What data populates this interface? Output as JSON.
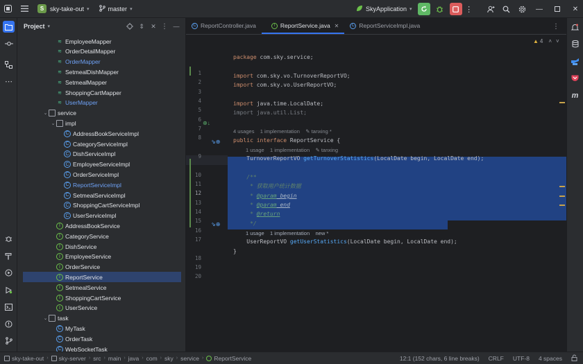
{
  "titlebar": {
    "project_badge": "S",
    "project_name": "sky-take-out",
    "branch": "master",
    "run_config": "SkyApplication"
  },
  "project_panel": {
    "title": "Project",
    "items": [
      {
        "label": "EmployeeMapper",
        "indent": 2,
        "icon": "mapper-icon",
        "color": "normal"
      },
      {
        "label": "OrderDetailMapper",
        "indent": 2,
        "icon": "mapper-icon",
        "color": "normal"
      },
      {
        "label": "OrderMapper",
        "indent": 2,
        "icon": "mapper-icon",
        "color": "blue"
      },
      {
        "label": "SetmealDishMapper",
        "indent": 2,
        "icon": "mapper-icon",
        "color": "normal"
      },
      {
        "label": "SetmealMapper",
        "indent": 2,
        "icon": "mapper-icon",
        "color": "normal"
      },
      {
        "label": "ShoppingCartMapper",
        "indent": 2,
        "icon": "mapper-icon",
        "color": "normal"
      },
      {
        "label": "UserMapper",
        "indent": 2,
        "icon": "mapper-icon",
        "color": "blue"
      },
      {
        "label": "service",
        "indent": 1,
        "icon": "folder-icon",
        "color": "normal",
        "arrow": "v"
      },
      {
        "label": "impl",
        "indent": 2,
        "icon": "folder-icon",
        "color": "normal",
        "arrow": "v"
      },
      {
        "label": "AddressBookServiceImpl",
        "indent": 3,
        "icon": "class-icon",
        "color": "normal"
      },
      {
        "label": "CategoryServiceImpl",
        "indent": 3,
        "icon": "class-icon",
        "color": "normal"
      },
      {
        "label": "DishServiceImpl",
        "indent": 3,
        "icon": "class-icon",
        "color": "normal"
      },
      {
        "label": "EmployeeServiceImpl",
        "indent": 3,
        "icon": "class-icon",
        "color": "normal"
      },
      {
        "label": "OrderServiceImpl",
        "indent": 3,
        "icon": "class-icon",
        "color": "normal"
      },
      {
        "label": "ReportServiceImpl",
        "indent": 3,
        "icon": "class-icon",
        "color": "blue"
      },
      {
        "label": "SetmealServiceImpl",
        "indent": 3,
        "icon": "class-icon",
        "color": "normal"
      },
      {
        "label": "ShoppingCartServiceImpl",
        "indent": 3,
        "icon": "class-icon",
        "color": "normal"
      },
      {
        "label": "UserServiceImpl",
        "indent": 3,
        "icon": "class-icon",
        "color": "normal"
      },
      {
        "label": "AddressBookService",
        "indent": 2,
        "icon": "interface-icon",
        "color": "normal"
      },
      {
        "label": "CategoryService",
        "indent": 2,
        "icon": "interface-icon",
        "color": "normal"
      },
      {
        "label": "DishService",
        "indent": 2,
        "icon": "interface-icon",
        "color": "normal"
      },
      {
        "label": "EmployeeService",
        "indent": 2,
        "icon": "interface-icon",
        "color": "normal"
      },
      {
        "label": "OrderService",
        "indent": 2,
        "icon": "interface-icon",
        "color": "normal"
      },
      {
        "label": "ReportService",
        "indent": 2,
        "icon": "interface-icon",
        "color": "normal",
        "selected": true
      },
      {
        "label": "SetmealService",
        "indent": 2,
        "icon": "interface-icon",
        "color": "normal"
      },
      {
        "label": "ShoppingCartService",
        "indent": 2,
        "icon": "interface-icon",
        "color": "normal"
      },
      {
        "label": "UserService",
        "indent": 2,
        "icon": "interface-icon",
        "color": "normal"
      },
      {
        "label": "task",
        "indent": 1,
        "icon": "folder-icon",
        "color": "normal",
        "arrow": "v"
      },
      {
        "label": "MyTask",
        "indent": 2,
        "icon": "class-icon",
        "color": "normal"
      },
      {
        "label": "OrderTask",
        "indent": 2,
        "icon": "class-icon",
        "color": "normal"
      },
      {
        "label": "WebSocketTask",
        "indent": 2,
        "icon": "class-icon",
        "color": "normal"
      }
    ]
  },
  "editor": {
    "tabs": [
      {
        "label": "ReportController.java",
        "icon": "class-icon",
        "active": false
      },
      {
        "label": "ReportService.java",
        "icon": "interface-icon",
        "active": true
      },
      {
        "label": "ReportServiceImpl.java",
        "icon": "class-icon",
        "active": false
      }
    ],
    "warning_count": "4",
    "hints": {
      "h1": "4 usages    1 implementation    ✎ tanxing *",
      "h2": "1 usage    1 implementation    ✎ tanxing",
      "h3": "1 usage    1 implementation    new *"
    },
    "lines": {
      "l1a": "package ",
      "l1b": "com.sky.service;",
      "l3a": "import ",
      "l3b": "com.sky.vo.TurnoverReportVO;",
      "l4a": "import ",
      "l4b": "com.sky.vo.UserReportVO;",
      "l6a": "import ",
      "l6b": "java.time.LocalDate;",
      "l7": "import java.util.List;",
      "l9a": "public interface ",
      "l9b": "ReportService {",
      "l10a": "    TurnoverReportVO ",
      "l10b": "getTurnoverStatistics",
      "l10c": "(LocalDate begin, LocalDate end);",
      "l12": "    /**",
      "l13": "     * 获取用户统计数据",
      "l14a": "     * ",
      "l14b": "@param",
      "l14c": " begin",
      "l15a": "     * ",
      "l15b": "@param",
      "l15c": " end",
      "l16a": "     * ",
      "l16b": "@return",
      "l17": "     */",
      "l18a": "    UserReportVO ",
      "l18b": "getUserStatistics",
      "l18c": "(LocalDate begin, LocalDate end);",
      "l19": "}"
    },
    "line_numbers": [
      "1",
      "2",
      "3",
      "4",
      "5",
      "6",
      "7",
      "8",
      "9",
      "10",
      "11",
      "12",
      "13",
      "14",
      "15",
      "16",
      "17",
      "18",
      "19",
      "20"
    ]
  },
  "statusbar": {
    "crumbs": [
      "sky-take-out",
      "sky-server",
      "src",
      "main",
      "java",
      "com",
      "sky",
      "service",
      "ReportService"
    ],
    "position": "12:1 (152 chars, 6 line breaks)",
    "line_sep": "CRLF",
    "encoding": "UTF-8",
    "indent": "4 spaces"
  },
  "colors": {
    "accent": "#3574f0",
    "selection": "#214283",
    "run_green": "#5fb865",
    "stop_red": "#db5c5c"
  }
}
